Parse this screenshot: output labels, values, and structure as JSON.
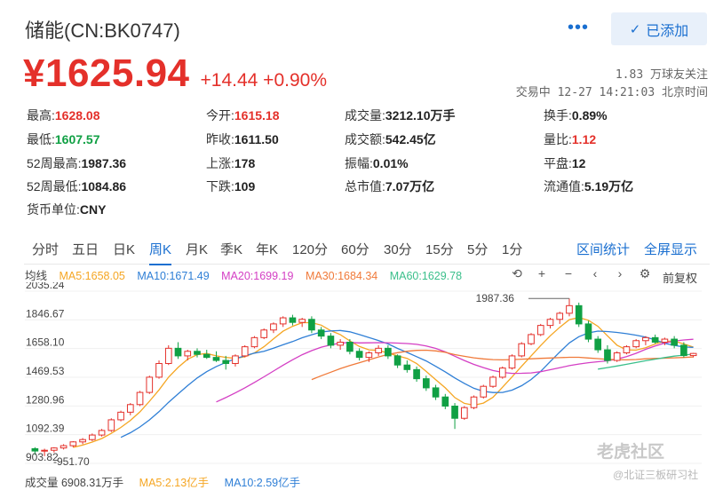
{
  "header": {
    "title": "储能(CN:BK0747)",
    "more_label": "•••",
    "added_label": "已添加"
  },
  "quote": {
    "price": "¥1625.94",
    "change": "+14.44 +0.90%",
    "followers": "1.83 万球友关注",
    "trade_time": "交易中 12-27 14:21:03 北京时间"
  },
  "stats": {
    "high_label": "最高:",
    "high": "1628.08",
    "low_label": "最低:",
    "low": "1607.57",
    "w52_high_label": "52周最高:",
    "w52_high": "1987.36",
    "w52_low_label": "52周最低:",
    "w52_low": "1084.86",
    "currency_label": "货币单位:",
    "currency": "CNY",
    "open_label": "今开:",
    "open": "1615.18",
    "prev_close_label": "昨收:",
    "prev_close": "1611.50",
    "up_label": "上涨:",
    "up": "178",
    "down_label": "下跌:",
    "down": "109",
    "volume_label": "成交量:",
    "volume": "3212.10万手",
    "amount_label": "成交额:",
    "amount": "542.45亿",
    "amplitude_label": "振幅:",
    "amplitude": "0.01%",
    "mktcap_label": "总市值:",
    "mktcap": "7.07万亿",
    "turnover_label": "换手:",
    "turnover": "0.89%",
    "vol_ratio_label": "量比:",
    "vol_ratio": "1.12",
    "flat_label": "平盘:",
    "flat": "12",
    "float_cap_label": "流通值:",
    "float_cap": "5.19万亿"
  },
  "tabs": [
    "分时",
    "五日",
    "日K",
    "周K",
    "月K",
    "季K",
    "年K",
    "120分",
    "60分",
    "30分",
    "15分",
    "5分",
    "1分"
  ],
  "tabs_right": [
    "区间统计",
    "全屏显示"
  ],
  "legend": {
    "avg_label": "均线",
    "ma5": "MA5:1658.05",
    "ma10": "MA10:1671.49",
    "ma20": "MA20:1699.19",
    "ma30": "MA30:1684.34",
    "ma60": "MA60:1629.78",
    "adjust_label": "前复权"
  },
  "colors": {
    "up": "#e4302a",
    "down": "#10a044",
    "ma5": "#f5a623",
    "ma10": "#2f7fd6",
    "ma20": "#d43fc4",
    "ma30": "#f07a3a",
    "ma60": "#3bbf8b"
  },
  "volume_bar": {
    "vol": "成交量 6908.31万手",
    "ma5": "MA5:2.13亿手",
    "ma10": "MA10:2.59亿手"
  },
  "watermark": {
    "brand": "老虎社区",
    "author": "@北证三板研习社"
  },
  "chart_data": {
    "type": "candlestick",
    "y_ticks": [
      "2035.24",
      "1846.67",
      "1658.10",
      "1469.53",
      "1280.96",
      "1092.39",
      "903.82"
    ],
    "ylim": [
      903.82,
      2035.24
    ],
    "low_annotation": "951.70",
    "high_annotation": "1987.36",
    "candles": [
      [
        1000,
        1010,
        960,
        985
      ],
      [
        985,
        1000,
        951.7,
        990
      ],
      [
        990,
        1010,
        975,
        1005
      ],
      [
        1005,
        1030,
        995,
        1020
      ],
      [
        1020,
        1050,
        1010,
        1045
      ],
      [
        1045,
        1070,
        1030,
        1060
      ],
      [
        1060,
        1100,
        1050,
        1090
      ],
      [
        1090,
        1130,
        1080,
        1120
      ],
      [
        1120,
        1200,
        1110,
        1190
      ],
      [
        1190,
        1250,
        1180,
        1240
      ],
      [
        1240,
        1300,
        1220,
        1290
      ],
      [
        1290,
        1380,
        1280,
        1370
      ],
      [
        1370,
        1480,
        1360,
        1470
      ],
      [
        1470,
        1580,
        1460,
        1560
      ],
      [
        1560,
        1680,
        1550,
        1660
      ],
      [
        1660,
        1700,
        1590,
        1610
      ],
      [
        1610,
        1650,
        1580,
        1640
      ],
      [
        1640,
        1660,
        1600,
        1620
      ],
      [
        1620,
        1650,
        1590,
        1600
      ],
      [
        1600,
        1640,
        1570,
        1580
      ],
      [
        1580,
        1610,
        1520,
        1560
      ],
      [
        1560,
        1620,
        1540,
        1610
      ],
      [
        1610,
        1680,
        1600,
        1670
      ],
      [
        1670,
        1740,
        1660,
        1730
      ],
      [
        1730,
        1790,
        1720,
        1780
      ],
      [
        1780,
        1830,
        1760,
        1820
      ],
      [
        1820,
        1870,
        1800,
        1860
      ],
      [
        1860,
        1880,
        1810,
        1830
      ],
      [
        1830,
        1860,
        1800,
        1850
      ],
      [
        1850,
        1870,
        1760,
        1780
      ],
      [
        1780,
        1800,
        1720,
        1740
      ],
      [
        1740,
        1760,
        1660,
        1680
      ],
      [
        1680,
        1720,
        1650,
        1700
      ],
      [
        1700,
        1720,
        1620,
        1640
      ],
      [
        1640,
        1660,
        1580,
        1600
      ],
      [
        1600,
        1640,
        1570,
        1630
      ],
      [
        1630,
        1680,
        1610,
        1660
      ],
      [
        1660,
        1680,
        1590,
        1610
      ],
      [
        1610,
        1620,
        1530,
        1550
      ],
      [
        1550,
        1580,
        1500,
        1520
      ],
      [
        1520,
        1540,
        1440,
        1460
      ],
      [
        1460,
        1480,
        1380,
        1400
      ],
      [
        1400,
        1420,
        1320,
        1340
      ],
      [
        1340,
        1360,
        1260,
        1280
      ],
      [
        1280,
        1300,
        1130,
        1200
      ],
      [
        1200,
        1280,
        1190,
        1270
      ],
      [
        1270,
        1350,
        1260,
        1340
      ],
      [
        1340,
        1420,
        1330,
        1410
      ],
      [
        1410,
        1480,
        1400,
        1470
      ],
      [
        1470,
        1540,
        1460,
        1530
      ],
      [
        1530,
        1620,
        1520,
        1610
      ],
      [
        1610,
        1700,
        1600,
        1690
      ],
      [
        1690,
        1760,
        1680,
        1750
      ],
      [
        1750,
        1820,
        1740,
        1810
      ],
      [
        1810,
        1860,
        1790,
        1850
      ],
      [
        1850,
        1900,
        1820,
        1890
      ],
      [
        1890,
        1987.36,
        1870,
        1940
      ],
      [
        1940,
        1960,
        1800,
        1820
      ],
      [
        1820,
        1840,
        1700,
        1720
      ],
      [
        1720,
        1740,
        1630,
        1650
      ],
      [
        1650,
        1680,
        1560,
        1580
      ],
      [
        1580,
        1640,
        1570,
        1630
      ],
      [
        1630,
        1680,
        1620,
        1670
      ],
      [
        1670,
        1720,
        1660,
        1710
      ],
      [
        1710,
        1740,
        1680,
        1730
      ],
      [
        1730,
        1750,
        1690,
        1700
      ],
      [
        1700,
        1730,
        1680,
        1720
      ],
      [
        1720,
        1740,
        1660,
        1680
      ],
      [
        1680,
        1700,
        1600,
        1612
      ],
      [
        1612,
        1630,
        1600,
        1626
      ]
    ]
  }
}
